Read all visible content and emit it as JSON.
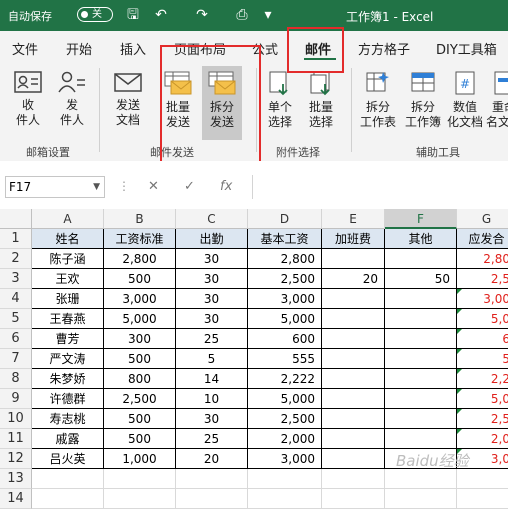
{
  "window": {
    "autosave_label": "自动保存",
    "autosave_state": "关",
    "document_title": "工作簿1  -  Excel"
  },
  "tabs": [
    "文件",
    "开始",
    "插入",
    "页面布局",
    "公式",
    "邮件",
    "方方格子",
    "DIY工具箱"
  ],
  "active_tab": "邮件",
  "ribbon": {
    "btn_recipients": "收\n件人",
    "btn_sender": "发\n件人",
    "btn_send_doc": "发送\n文档",
    "btn_bulk_send": "批量\n发送",
    "btn_split_send": "拆分\n发送",
    "btn_single_select": "单个\n选择",
    "btn_bulk_select": "批量\n选择",
    "btn_split_ws": "拆分\n工作表",
    "btn_split_wb": "拆分\n工作簿",
    "btn_numeric": "数值\n化文档",
    "btn_rename": "重命\n名文档",
    "group_mailbox": "邮箱设置",
    "group_mail_send": "邮件发送",
    "group_attachment": "附件选择",
    "group_tools": "辅助工具"
  },
  "formula_bar": {
    "name_box": "F17",
    "fx": "fx",
    "value": ""
  },
  "grid": {
    "columns": [
      "A",
      "B",
      "C",
      "D",
      "E",
      "F",
      "G"
    ],
    "selected_column": "F",
    "rows": [
      [
        "姓名",
        "工资标准",
        "出勤",
        "基本工资",
        "加班费",
        "其他",
        "应发合"
      ],
      [
        "陈子涵",
        "2,800",
        "30",
        "2,800",
        "",
        "",
        "2,80"
      ],
      [
        "王欢",
        "500",
        "30",
        "2,500",
        "20",
        "50",
        "2,5"
      ],
      [
        "张珊",
        "3,000",
        "30",
        "3,000",
        "",
        "",
        "3,00"
      ],
      [
        "王春燕",
        "5,000",
        "30",
        "5,000",
        "",
        "",
        "5,0"
      ],
      [
        "曹芳",
        "300",
        "25",
        "600",
        "",
        "",
        "6"
      ],
      [
        "严文涛",
        "500",
        "5",
        "555",
        "",
        "",
        "5"
      ],
      [
        "朱梦娇",
        "800",
        "14",
        "2,222",
        "",
        "",
        "2,2"
      ],
      [
        "许德群",
        "2,500",
        "10",
        "5,000",
        "",
        "",
        "5,0"
      ],
      [
        "寿志桃",
        "500",
        "30",
        "2,500",
        "",
        "",
        "2,5"
      ],
      [
        "戚露",
        "500",
        "25",
        "2,000",
        "",
        "",
        "2,0"
      ],
      [
        "吕火英",
        "1,000",
        "20",
        "3,000",
        "",
        "",
        "3,0"
      ]
    ],
    "row_numbers": [
      "1",
      "2",
      "3",
      "4",
      "5",
      "6",
      "7",
      "8",
      "9",
      "10",
      "11",
      "12",
      "13",
      "14"
    ]
  },
  "colors": {
    "accent": "#217346",
    "highlight": "#e32b2b",
    "header_fill": "#dce6f1",
    "negative_text": "#e0201b"
  },
  "watermark": "Baidu经验"
}
